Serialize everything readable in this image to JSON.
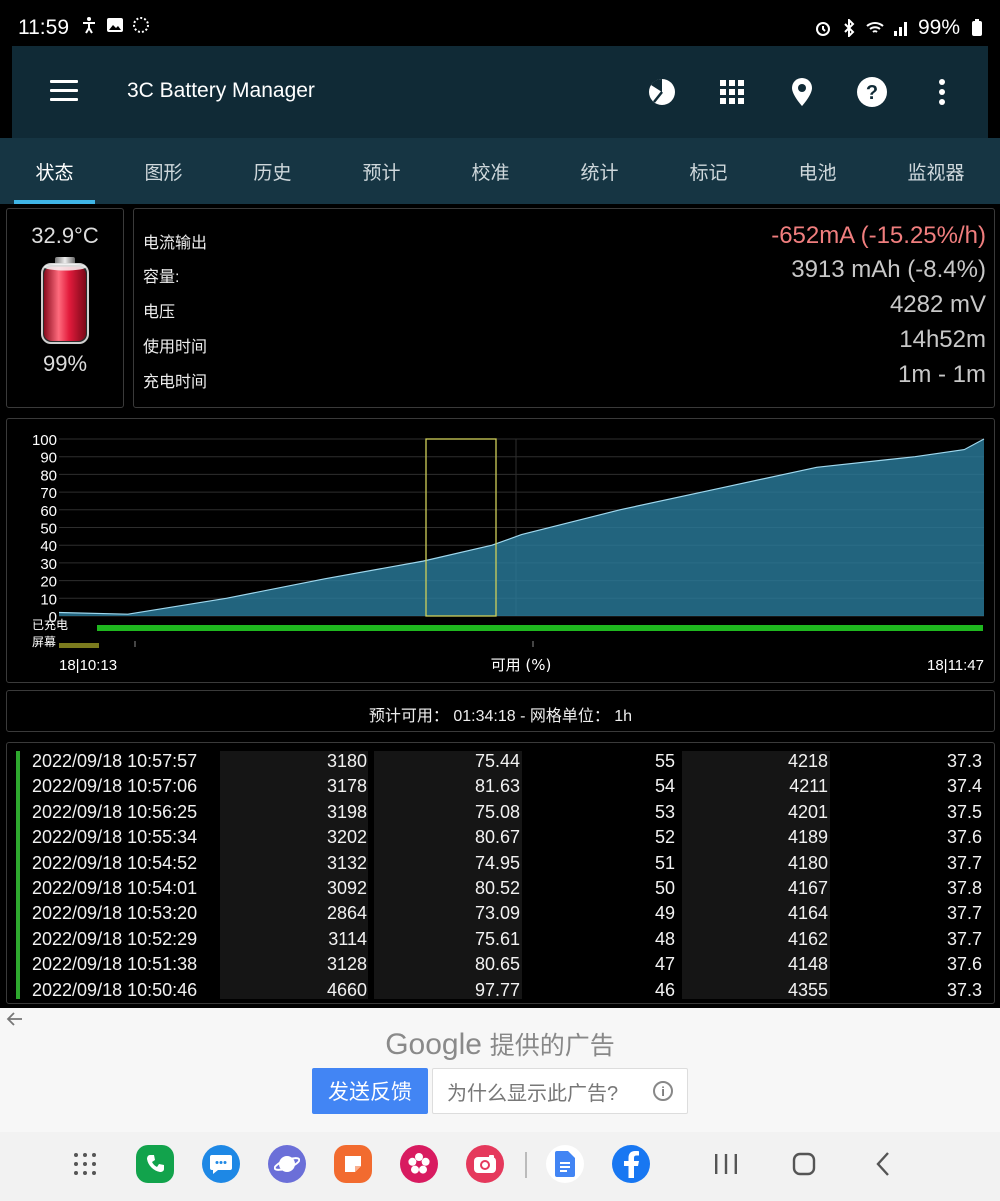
{
  "status_bar": {
    "time": "11:59",
    "battery_pct": "99%",
    "left_icons": [
      "accessibility-icon",
      "image-icon",
      "loading-icon"
    ],
    "right_icons": [
      "alarm-icon",
      "bluetooth-icon",
      "wifi-icon",
      "signal-icon",
      "battery-icon"
    ]
  },
  "app_bar": {
    "title": "3C Battery Manager",
    "actions": [
      "pie-chart-icon",
      "grid-icon",
      "location-pin-icon",
      "help-icon",
      "more-vert-icon"
    ]
  },
  "tabs": [
    {
      "label": "状态",
      "active": true
    },
    {
      "label": "图形"
    },
    {
      "label": "历史"
    },
    {
      "label": "预计"
    },
    {
      "label": "校准"
    },
    {
      "label": "统计"
    },
    {
      "label": "标记"
    },
    {
      "label": "电池"
    },
    {
      "label": "监视器"
    }
  ],
  "summary": {
    "temperature": "32.9°C",
    "level": "99%",
    "level_fraction": 0.99
  },
  "stats": [
    {
      "label": "电流输出",
      "value": "-652mA (-15.25%/h)",
      "negative": true
    },
    {
      "label": "容量:",
      "value": "3913 mAh (-8.4%)"
    },
    {
      "label": "电压",
      "value": "4282 mV"
    },
    {
      "label": "使用时间",
      "value": "14h52m"
    },
    {
      "label": "充电时间",
      "value": "1m - 1m"
    }
  ],
  "chart_data": {
    "type": "area",
    "y_ticks": [
      "100",
      "90",
      "80",
      "70",
      "60",
      "50",
      "40",
      "30",
      "20",
      "10",
      "0"
    ],
    "ylim": [
      0,
      100
    ],
    "x_start_label": "18|10:13",
    "x_end_label": "18|11:47",
    "x_center_label": "可用 (%)",
    "x": [
      "10:13",
      "10:20",
      "10:30",
      "10:40",
      "10:50",
      "10:57",
      "11:00",
      "11:10",
      "11:20",
      "11:30",
      "11:40",
      "11:45",
      "11:47"
    ],
    "values": [
      2,
      1,
      10,
      21,
      31,
      40,
      46,
      60,
      72,
      84,
      90,
      94,
      100
    ],
    "lanes": [
      {
        "label": "已充电",
        "color": "#1fb71f"
      },
      {
        "label": "屏幕",
        "color": "#7b7b1e"
      }
    ],
    "grid": true,
    "highlight_window_color": "#cfcf5a"
  },
  "forecast": {
    "text": "预计可用： 01:34:18 - 网格单位： 1h"
  },
  "log": {
    "rows": [
      {
        "datetime": "2022/09/18  10:57:57",
        "mah": "3180",
        "ma": "75.44",
        "level": "55",
        "mv": "4218",
        "temp": "37.3"
      },
      {
        "datetime": "2022/09/18  10:57:06",
        "mah": "3178",
        "ma": "81.63",
        "level": "54",
        "mv": "4211",
        "temp": "37.4"
      },
      {
        "datetime": "2022/09/18  10:56:25",
        "mah": "3198",
        "ma": "75.08",
        "level": "53",
        "mv": "4201",
        "temp": "37.5"
      },
      {
        "datetime": "2022/09/18  10:55:34",
        "mah": "3202",
        "ma": "80.67",
        "level": "52",
        "mv": "4189",
        "temp": "37.6"
      },
      {
        "datetime": "2022/09/18  10:54:52",
        "mah": "3132",
        "ma": "74.95",
        "level": "51",
        "mv": "4180",
        "temp": "37.7"
      },
      {
        "datetime": "2022/09/18  10:54:01",
        "mah": "3092",
        "ma": "80.52",
        "level": "50",
        "mv": "4167",
        "temp": "37.8"
      },
      {
        "datetime": "2022/09/18  10:53:20",
        "mah": "2864",
        "ma": "73.09",
        "level": "49",
        "mv": "4164",
        "temp": "37.7"
      },
      {
        "datetime": "2022/09/18  10:52:29",
        "mah": "3114",
        "ma": "75.61",
        "level": "48",
        "mv": "4162",
        "temp": "37.7"
      },
      {
        "datetime": "2022/09/18  10:51:38",
        "mah": "3128",
        "ma": "80.65",
        "level": "47",
        "mv": "4148",
        "temp": "37.6"
      },
      {
        "datetime": "2022/09/18  10:50:46",
        "mah": "4660",
        "ma": "97.77",
        "level": "46",
        "mv": "4355",
        "temp": "37.3"
      }
    ]
  },
  "ad": {
    "brand": "Google",
    "tagline": "提供的广告",
    "feedback_button": "发送反馈",
    "why_button": "为什么显示此广告?",
    "back_icon": "arrow-left-icon",
    "info_icon": "info-icon",
    "info_glyph": "i"
  },
  "navbar": {
    "apps": [
      {
        "name": "app-drawer-icon",
        "color": "#f2f2f2"
      },
      {
        "name": "phone-icon",
        "color": "#12a34c"
      },
      {
        "name": "messages-icon",
        "color": "#1e88e5"
      },
      {
        "name": "internet-icon",
        "color": "#6b6fd8"
      },
      {
        "name": "notes-icon",
        "color": "#f26b2f"
      },
      {
        "name": "flower-icon",
        "color": "#d81b60"
      },
      {
        "name": "camera-icon",
        "color": "#e5395c"
      },
      {
        "name": "docs-icon",
        "color": "#ffffff"
      },
      {
        "name": "facebook-icon",
        "color": "#1877f2"
      }
    ],
    "system": [
      "recents-icon",
      "home-icon",
      "back-icon"
    ]
  }
}
